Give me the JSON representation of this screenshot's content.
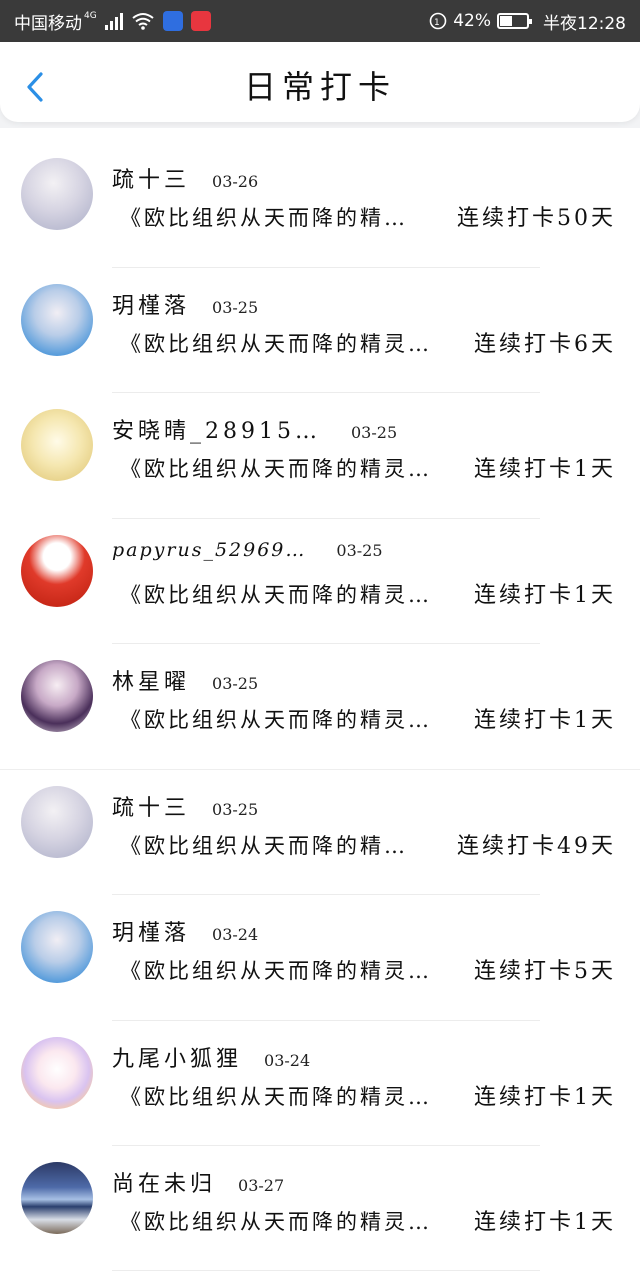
{
  "status_bar": {
    "carrier": "中国移动",
    "network": "4G",
    "battery_percent": "42%",
    "battery_level": 0.42,
    "time": "半夜12:28",
    "icons": [
      "signal-icon",
      "wifi-icon",
      "baidu-app-icon",
      "huawei-app-icon",
      "eye-comfort-icon",
      "battery-icon"
    ]
  },
  "header": {
    "title": "日常打卡",
    "back_icon": "chevron-left-icon"
  },
  "checkins": [
    {
      "name": "疏十三",
      "date": "03-26",
      "preview": "《欧比组织从天而降的精…",
      "streak": "连续打卡50天"
    },
    {
      "name": "玥槿落",
      "date": "03-25",
      "preview": "《欧比组织从天而降的精灵…",
      "streak": "连续打卡6天"
    },
    {
      "name": "安晓晴_28915…",
      "date": "03-25",
      "preview": "《欧比组织从天而降的精灵…",
      "streak": "连续打卡1天"
    },
    {
      "name": "papyrus_52969…",
      "date": "03-25",
      "preview": "《欧比组织从天而降的精灵…",
      "streak": "连续打卡1天"
    },
    {
      "name": "林星曜",
      "date": "03-25",
      "preview": "《欧比组织从天而降的精灵…",
      "streak": "连续打卡1天"
    },
    {
      "name": "疏十三",
      "date": "03-25",
      "preview": "《欧比组织从天而降的精…",
      "streak": "连续打卡49天"
    },
    {
      "name": "玥槿落",
      "date": "03-24",
      "preview": "《欧比组织从天而降的精灵…",
      "streak": "连续打卡5天"
    },
    {
      "name": "九尾小狐狸",
      "date": "03-24",
      "preview": "《欧比组织从天而降的精灵…",
      "streak": "连续打卡1天"
    },
    {
      "name": "尚在未归",
      "date": "03-27",
      "preview": "《欧比组织从天而降的精灵…",
      "streak": "连续打卡1天"
    }
  ],
  "colors": {
    "accent": "#2b8fe6",
    "status_bar": "#3a3a3a"
  }
}
